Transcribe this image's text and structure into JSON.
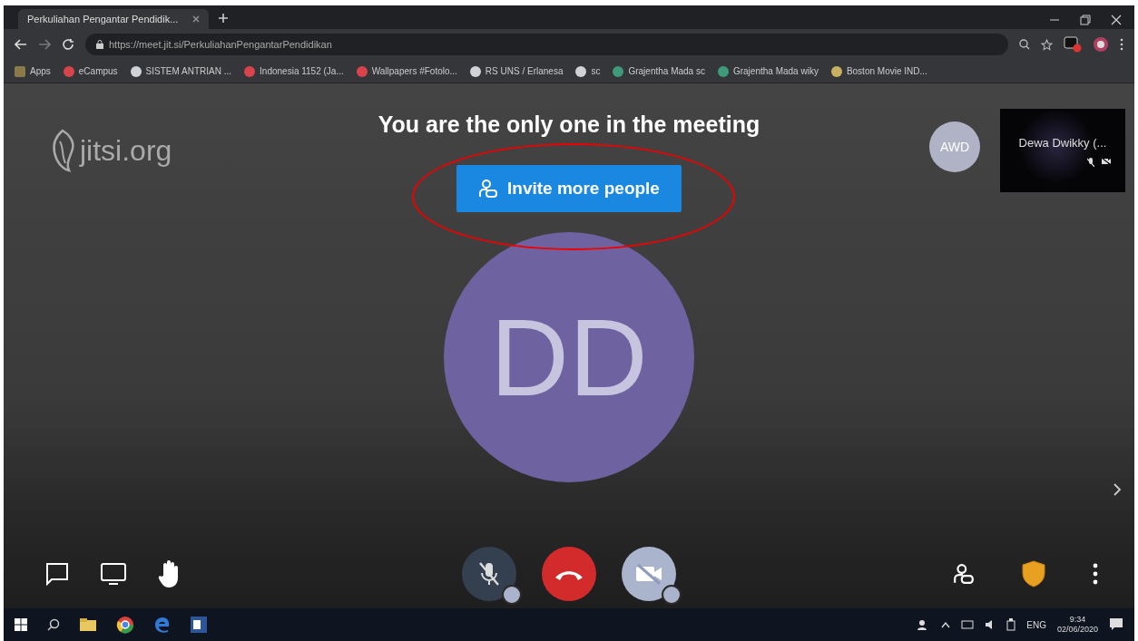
{
  "browser": {
    "tab_title": "Perkuliahan Pengantar Pendidik...",
    "url": "https://meet.jit.si/PerkuliahanPengantarPendidikan",
    "bookmarks": [
      {
        "label": "Apps",
        "color": "#8a7a4a"
      },
      {
        "label": "eCampus",
        "color": "#d9434b"
      },
      {
        "label": "SISTEM ANTRIAN ...",
        "color": "#cfd3d8"
      },
      {
        "label": "Indonesia 1152 (Ja...",
        "color": "#d9434b"
      },
      {
        "label": "Wallpapers #Fotolo...",
        "color": "#d9434b"
      },
      {
        "label": "RS UNS / Erlanesa",
        "color": "#cfd3d8"
      },
      {
        "label": "sc",
        "color": "#cfd3d8"
      },
      {
        "label": "Grajentha Mada sc",
        "color": "#3f9a7a"
      },
      {
        "label": "Grajentha Mada wiky",
        "color": "#3f9a7a"
      },
      {
        "label": "Boston Movie IND...",
        "color": "#c8b060"
      }
    ]
  },
  "meeting": {
    "logo": "jitsi.org",
    "notice": "You are the only one in the meeting",
    "invite_button": "Invite more people",
    "avatar_initials": "DD",
    "remote_avatar": "AWD",
    "thumbnail_name": "Dewa Dwikky (...",
    "mic_muted": true,
    "camera_muted": true
  },
  "taskbar": {
    "language": "ENG",
    "time": "9:34",
    "date": "02/06/2020"
  }
}
